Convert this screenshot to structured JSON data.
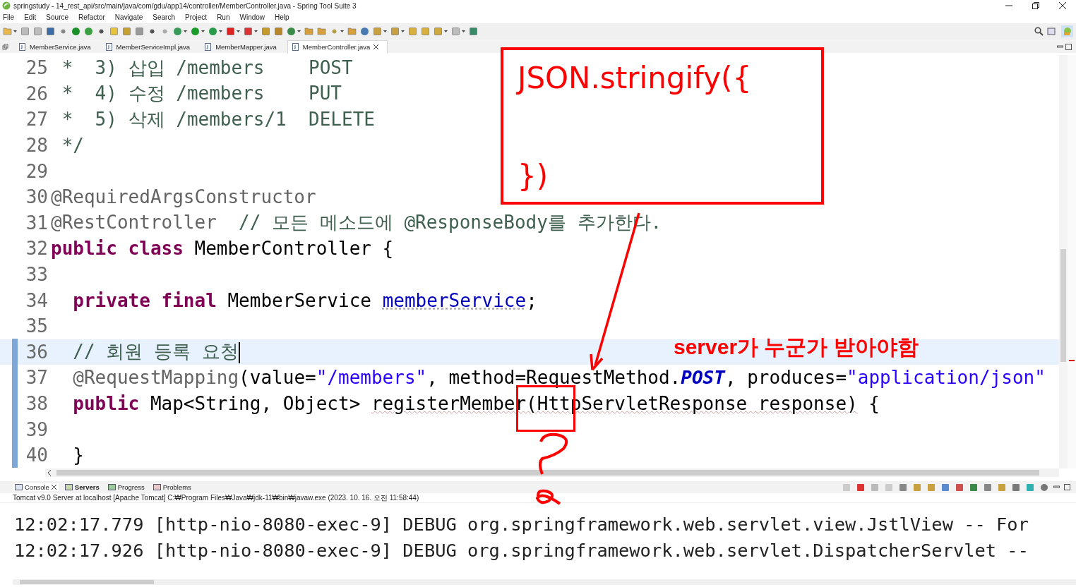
{
  "window": {
    "title": "springstudy - 14_rest_api/src/main/java/com/gdu/app14/controller/MemberController.java - Spring Tool Suite 3"
  },
  "menu": [
    "File",
    "Edit",
    "Source",
    "Refactor",
    "Navigate",
    "Search",
    "Project",
    "Run",
    "Window",
    "Help"
  ],
  "editor_tabs": [
    {
      "label": "MemberService.java",
      "selected": false
    },
    {
      "label": "MemberServiceImpl.java",
      "selected": false
    },
    {
      "label": "MemberMapper.java",
      "selected": false
    },
    {
      "label": "MemberController.java",
      "selected": true
    }
  ],
  "code_lines": [
    {
      "number": "25",
      "current": false,
      "segments": [
        {
          "kind": "comment",
          "text": " *  3) 삽입 /members    POST"
        }
      ]
    },
    {
      "number": "26",
      "current": false,
      "segments": [
        {
          "kind": "comment",
          "text": " *  4) 수정 /members    PUT"
        }
      ]
    },
    {
      "number": "27",
      "current": false,
      "segments": [
        {
          "kind": "comment",
          "text": " *  5) 삭제 /members/1  DELETE"
        }
      ]
    },
    {
      "number": "28",
      "current": false,
      "segments": [
        {
          "kind": "comment",
          "text": " */"
        }
      ]
    },
    {
      "number": "29",
      "current": false
    },
    {
      "number": "30",
      "current": false,
      "segments": [
        {
          "kind": "annotation",
          "text": "@RequiredArgsConstructor"
        }
      ]
    },
    {
      "number": "31",
      "current": false,
      "segments": [
        {
          "kind": "annotation",
          "text": "@RestController"
        },
        {
          "kind": "comment",
          "text": "  // 모든 메소드에 @ResponseBody를 추가한다."
        }
      ]
    },
    {
      "number": "32",
      "current": false,
      "segments": [
        {
          "kind": "keyword",
          "text": "public class"
        },
        {
          "kind": "plain",
          "text": " MemberController {"
        }
      ]
    },
    {
      "number": "33",
      "current": false
    },
    {
      "number": "34",
      "current": false,
      "segments": [
        {
          "kind": "keyword",
          "text": "  private final"
        },
        {
          "kind": "plain",
          "text": " MemberService "
        },
        {
          "kind": "field",
          "text": "memberService"
        },
        {
          "kind": "plain",
          "text": ";"
        }
      ]
    },
    {
      "number": "35",
      "current": false
    },
    {
      "number": "36",
      "current": true,
      "segments": [
        {
          "kind": "comment",
          "text": "  // 회원 등록 요청"
        }
      ]
    },
    {
      "number": "37",
      "current": false,
      "segments": [
        {
          "kind": "annotation",
          "text": "  @RequestMapping"
        },
        {
          "kind": "plain",
          "text": "(value="
        },
        {
          "kind": "string",
          "text": "\"/members\""
        },
        {
          "kind": "plain",
          "text": ", method=RequestMethod."
        },
        {
          "kind": "constant",
          "text": "POST"
        },
        {
          "kind": "plain",
          "text": ", produces="
        },
        {
          "kind": "string",
          "text": "\"application/json\""
        }
      ]
    },
    {
      "number": "38",
      "current": false,
      "segments": [
        {
          "kind": "keyword",
          "text": "  public"
        },
        {
          "kind": "plain",
          "text": " Map<String, Object> "
        },
        {
          "kind": "warn",
          "text": "registerMember(HttpServletResponse response)"
        },
        {
          "kind": "plain",
          "text": " {"
        }
      ]
    },
    {
      "number": "39",
      "current": false
    },
    {
      "number": "40",
      "current": false,
      "segments": [
        {
          "kind": "plain",
          "text": "  }"
        }
      ]
    }
  ],
  "annotations": {
    "note_box_lines": [
      "JSON.stringify({",
      "})"
    ],
    "note": "server가 누군가 받아야함"
  },
  "console_tabs": [
    {
      "label": "Console",
      "selected": true,
      "changed": false
    },
    {
      "label": "Servers",
      "selected": false,
      "changed": true
    },
    {
      "label": "Progress",
      "selected": false,
      "changed": false
    },
    {
      "label": "Problems",
      "selected": false,
      "changed": false
    }
  ],
  "console": {
    "header": "Tomcat v9.0 Server at localhost [Apache Tomcat] C:₩Program Files₩Java₩jdk-11₩bin₩javaw.exe  (2023. 10. 16. 오전 11:58:44)",
    "lines": [
      "12:02:17.779 [http-nio-8080-exec-9] DEBUG org.springframework.web.servlet.view.JstlView -- For",
      "12:02:17.926 [http-nio-8080-exec-9] DEBUG org.springframework.web.servlet.DispatcherServlet --"
    ]
  }
}
